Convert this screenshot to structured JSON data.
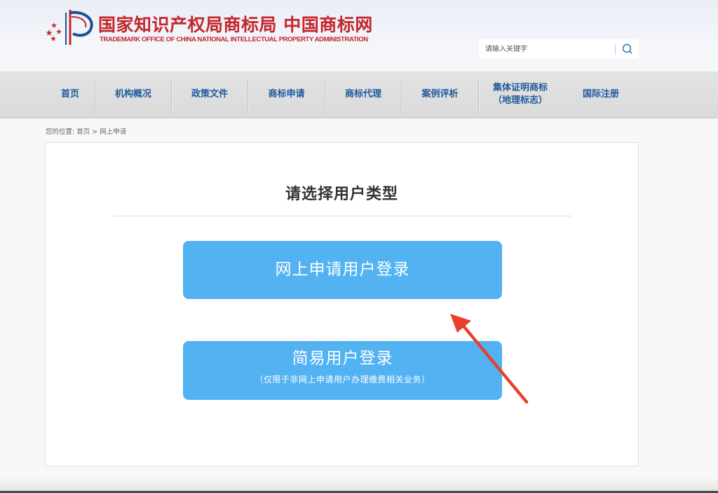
{
  "brand": {
    "title": "国家知识产权局商标局 中国商标网",
    "subtitle": "TRADEMARK OFFICE OF CHINA NATIONAL INTELLECTUAL PROPERTY ADMINISTRATION",
    "emblem_icon": "cnipa-emblem-icon",
    "color": "#c4262c"
  },
  "search": {
    "placeholder": "请输入关键字",
    "value": "",
    "icon": "search-icon"
  },
  "nav": {
    "items": [
      {
        "label": "首页"
      },
      {
        "label": "机构概况"
      },
      {
        "label": "政策文件"
      },
      {
        "label": "商标申请"
      },
      {
        "label": "商标代理"
      },
      {
        "label": "案例评析"
      },
      {
        "label": "集体证明商标",
        "label2": "（地理标志）"
      },
      {
        "label": "国际注册"
      }
    ],
    "color": "#1e5a9c"
  },
  "breadcrumb": {
    "prefix": "您的位置:",
    "home": "首页",
    "separator": ">",
    "current": "网上申请"
  },
  "main": {
    "title": "请选择用户类型",
    "online_login": {
      "label": "网上申请用户登录"
    },
    "simple_login": {
      "label": "简易用户登录",
      "note": "（仅限于非网上申请用户办理缴费相关业务）"
    },
    "button_color": "#53b2f2",
    "annotation": {
      "icon": "arrow-icon",
      "color": "#e8412c"
    }
  }
}
